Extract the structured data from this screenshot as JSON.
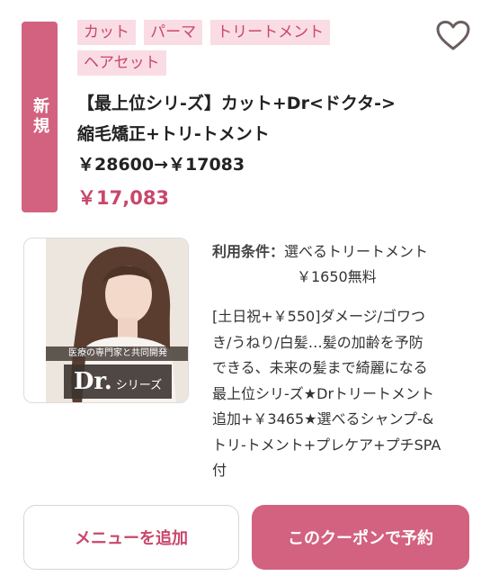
{
  "coupon": {
    "badge": "新規",
    "tags": [
      "カット",
      "パーマ",
      "トリートメント",
      "ヘアセット"
    ],
    "title_lines": [
      "【最上位シリ-ズ】カット+Dr<ドクタ->",
      "縮毛矯正+トリ-トメント",
      "￥28600→￥17083"
    ],
    "price": "￥17,083",
    "image": {
      "caption": "医療の専門家と共同開発",
      "brand": "Dr.",
      "brand_suffix": "シリーズ"
    },
    "conditions": {
      "label": "利用条件：",
      "value": "選べるトリートメント",
      "value_line2": "￥1650無料"
    },
    "description_lines": [
      "[土日祝+￥550]ダメージ/ゴワつ",
      "き/うねり/白髪…髪の加齢を予防",
      "できる、未来の髪まで綺麗になる",
      "最上位シリ-ズ★Drトリートメント",
      "追加+￥3465★選べるシャンプ-&",
      "トリ-トメント+プレケア+プチSPA",
      "付"
    ]
  },
  "actions": {
    "add_menu_label": "メニューを追加",
    "reserve_label": "このクーポンで予約"
  },
  "icons": {
    "favorite": "heart-outline-icon"
  },
  "colors": {
    "accent": "#d2627f",
    "accent_text": "#c9476b",
    "tag_bg": "#fadce4"
  }
}
